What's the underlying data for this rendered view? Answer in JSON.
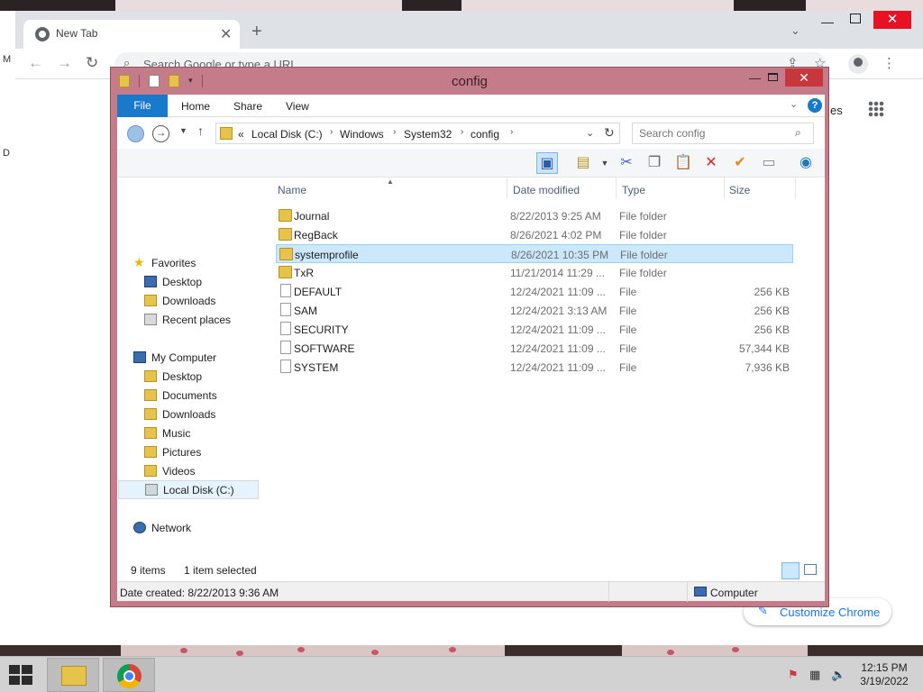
{
  "chrome": {
    "tab_title": "New Tab",
    "omnibox_placeholder": "Search Google or type a URL",
    "images_link": "es",
    "customize_label": "Customize Chrome",
    "left_edge_letters": [
      "M",
      "D"
    ]
  },
  "explorer": {
    "window_title": "config",
    "ribbon_tabs": [
      "File",
      "Home",
      "Share",
      "View"
    ],
    "breadcrumb_prefix": "«",
    "breadcrumb": [
      "Local Disk (C:)",
      "Windows",
      "System32",
      "config"
    ],
    "search_placeholder": "Search config",
    "nav": {
      "favorites": "Favorites",
      "fav_items": [
        "Desktop",
        "Downloads",
        "Recent places"
      ],
      "computer": "My Computer",
      "computer_items": [
        "Desktop",
        "Documents",
        "Downloads",
        "Music",
        "Pictures",
        "Videos",
        "Local Disk (C:)"
      ],
      "network": "Network"
    },
    "columns": [
      "Name",
      "Date modified",
      "Type",
      "Size"
    ],
    "files": [
      {
        "name": "Journal",
        "date": "8/22/2013 9:25 AM",
        "type": "File folder",
        "size": "",
        "kind": "folder"
      },
      {
        "name": "RegBack",
        "date": "8/26/2021 4:02 PM",
        "type": "File folder",
        "size": "",
        "kind": "folder"
      },
      {
        "name": "systemprofile",
        "date": "8/26/2021 10:35 PM",
        "type": "File folder",
        "size": "",
        "kind": "folder",
        "selected": true
      },
      {
        "name": "TxR",
        "date": "11/21/2014 11:29 ...",
        "type": "File folder",
        "size": "",
        "kind": "folder"
      },
      {
        "name": "DEFAULT",
        "date": "12/24/2021 11:09 ...",
        "type": "File",
        "size": "256 KB",
        "kind": "file"
      },
      {
        "name": "SAM",
        "date": "12/24/2021 3:13 AM",
        "type": "File",
        "size": "256 KB",
        "kind": "file"
      },
      {
        "name": "SECURITY",
        "date": "12/24/2021 11:09 ...",
        "type": "File",
        "size": "256 KB",
        "kind": "file"
      },
      {
        "name": "SOFTWARE",
        "date": "12/24/2021 11:09 ...",
        "type": "File",
        "size": "57,344 KB",
        "kind": "file"
      },
      {
        "name": "SYSTEM",
        "date": "12/24/2021 11:09 ...",
        "type": "File",
        "size": "7,936 KB",
        "kind": "file"
      }
    ],
    "item_count": "9 items",
    "selection_count": "1 item selected",
    "status_text": "Date created: 8/22/2013 9:36 AM",
    "status_location": "Computer"
  },
  "taskbar": {
    "time": "12:15 PM",
    "date": "3/19/2022"
  },
  "colors": {
    "explorer_frame": "#c47c8a",
    "ribbon_file": "#1979ca",
    "selection": "#cce8ff",
    "close_button": "#c7373b"
  }
}
